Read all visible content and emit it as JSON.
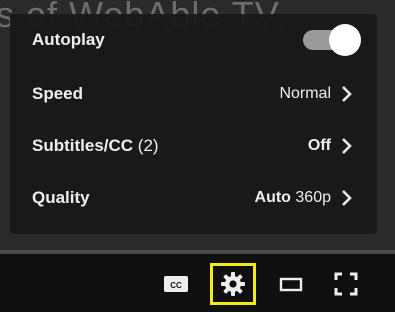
{
  "background_caption": "s of WebAble TV.",
  "menu": {
    "autoplay": {
      "label": "Autoplay",
      "enabled": true
    },
    "speed": {
      "label": "Speed",
      "value": "Normal"
    },
    "subtitles": {
      "label": "Subtitles/CC",
      "count": "(2)",
      "value": "Off"
    },
    "quality": {
      "label": "Quality",
      "value_auto": "Auto",
      "value_res": "360p"
    }
  },
  "controls": {
    "icons": [
      "cc-icon",
      "gear-icon",
      "theater-mode-icon",
      "fullscreen-icon"
    ],
    "cc_text": "CC",
    "highlight_color": "#f4ea18"
  }
}
